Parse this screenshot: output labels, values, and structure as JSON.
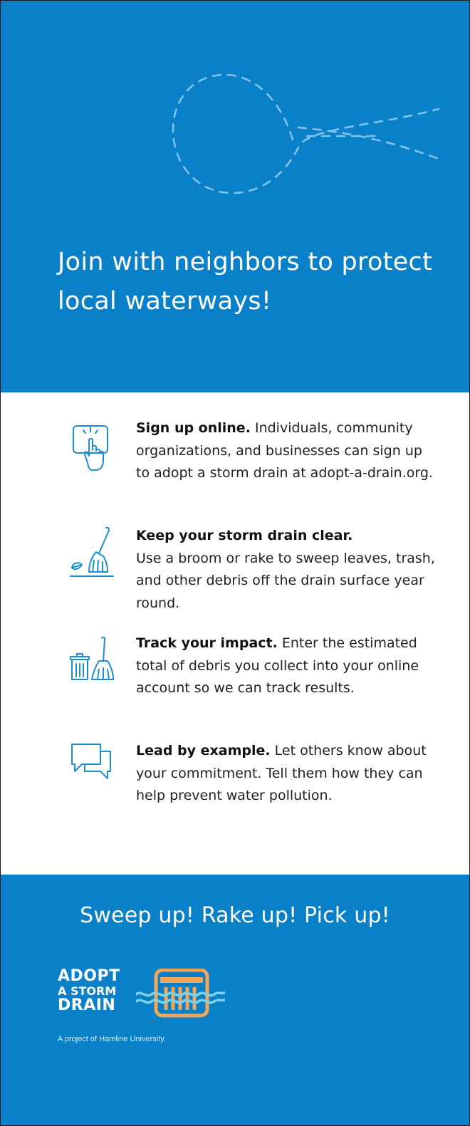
{
  "headline": "Join with neighbors to protect local waterways!",
  "steps": [
    {
      "icon": "touch-tap-icon",
      "title": "Sign up online.",
      "body": "Individuals, community organizations, and businesses can sign up to adopt a storm drain at adopt-a-drain.org."
    },
    {
      "icon": "broom-icon",
      "title": "Keep your storm drain clear.",
      "body": "Use a broom or rake to sweep leaves, trash, and other debris off the drain surface year round."
    },
    {
      "icon": "trash-and-broom-icon",
      "title": "Track your impact.",
      "body": "Enter the estimated total of debris you collect into your online account so we can track results."
    },
    {
      "icon": "chat-bubbles-icon",
      "title": "Lead by example.",
      "body": "Let others know about your commitment. Tell them how they can help prevent water pollution."
    }
  ],
  "tagline": "Sweep up! Rake up! Pick up!",
  "logo": {
    "line1": "ADOPT",
    "line2": "A STORM",
    "line3": "DRAIN"
  },
  "credit": "A project of Hamline University.",
  "colors": {
    "brand_blue": "#0a80c9",
    "icon_blue": "#1a8fd6",
    "logo_orange": "#f2a65a",
    "logo_wave": "#7fd3e6"
  }
}
